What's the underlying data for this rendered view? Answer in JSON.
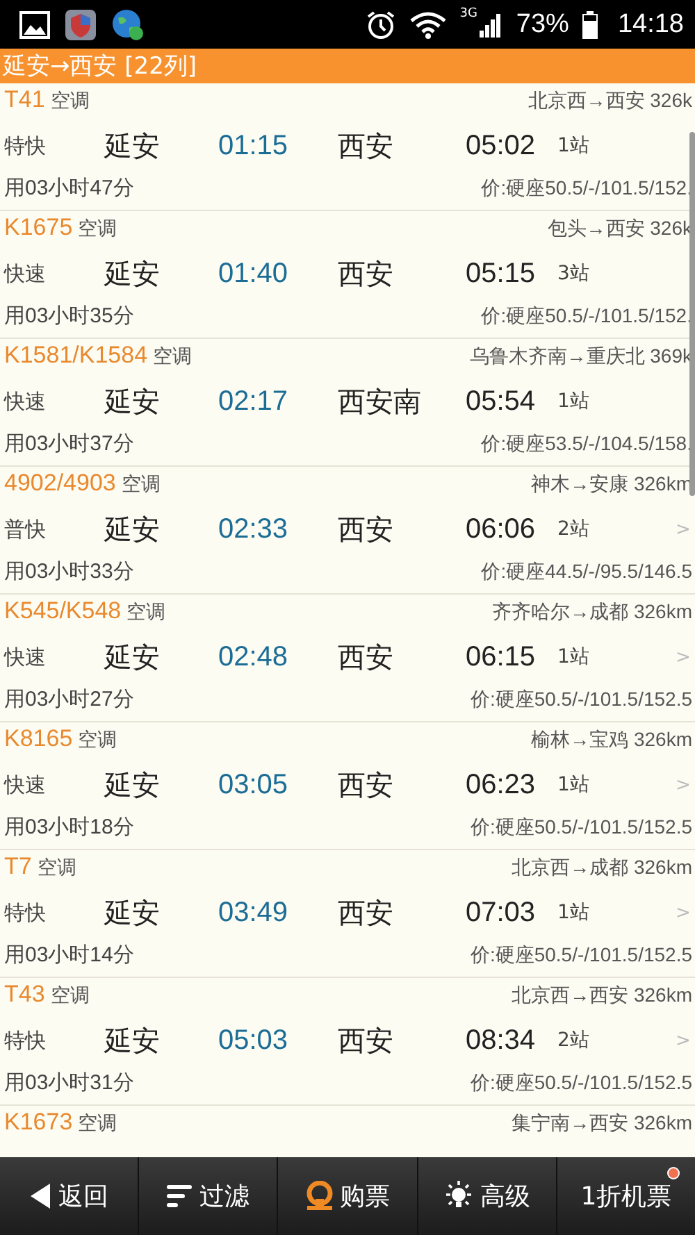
{
  "status_bar": {
    "network": "3G",
    "battery": "73%",
    "time": "14:18"
  },
  "header": {
    "title": "延安→西安 [22列]"
  },
  "trains": [
    {
      "number": "T41",
      "ac": "空调",
      "route": "北京西→西安 326k",
      "type": "特快",
      "from": "延安",
      "depart": "01:15",
      "to": "西安",
      "arrive": "05:02",
      "stops": "1站",
      "duration": "用03小时47分",
      "price": "价:硬座50.5/-/101.5/152."
    },
    {
      "number": "K1675",
      "ac": "空调",
      "route": "包头→西安 326k",
      "type": "快速",
      "from": "延安",
      "depart": "01:40",
      "to": "西安",
      "arrive": "05:15",
      "stops": "3站",
      "duration": "用03小时35分",
      "price": "价:硬座50.5/-/101.5/152."
    },
    {
      "number": "K1581/K1584",
      "ac": "空调",
      "route": "乌鲁木齐南→重庆北 369k",
      "type": "快速",
      "from": "延安",
      "depart": "02:17",
      "to": "西安南",
      "arrive": "05:54",
      "stops": "1站",
      "duration": "用03小时37分",
      "price": "价:硬座53.5/-/104.5/158."
    },
    {
      "number": "4902/4903",
      "ac": "空调",
      "route": "神木→安康 326km",
      "type": "普快",
      "from": "延安",
      "depart": "02:33",
      "to": "西安",
      "arrive": "06:06",
      "stops": "2站",
      "arrow": ">",
      "duration": "用03小时33分",
      "price": "价:硬座44.5/-/95.5/146.5"
    },
    {
      "number": "K545/K548",
      "ac": "空调",
      "route": "齐齐哈尔→成都 326km",
      "type": "快速",
      "from": "延安",
      "depart": "02:48",
      "to": "西安",
      "arrive": "06:15",
      "stops": "1站",
      "arrow": ">",
      "duration": "用03小时27分",
      "price": "价:硬座50.5/-/101.5/152.5"
    },
    {
      "number": "K8165",
      "ac": "空调",
      "route": "榆林→宝鸡 326km",
      "type": "快速",
      "from": "延安",
      "depart": "03:05",
      "to": "西安",
      "arrive": "06:23",
      "stops": "1站",
      "arrow": ">",
      "duration": "用03小时18分",
      "price": "价:硬座50.5/-/101.5/152.5"
    },
    {
      "number": "T7",
      "ac": "空调",
      "route": "北京西→成都 326km",
      "type": "特快",
      "from": "延安",
      "depart": "03:49",
      "to": "西安",
      "arrive": "07:03",
      "stops": "1站",
      "arrow": ">",
      "duration": "用03小时14分",
      "price": "价:硬座50.5/-/101.5/152.5"
    },
    {
      "number": "T43",
      "ac": "空调",
      "route": "北京西→西安 326km",
      "type": "特快",
      "from": "延安",
      "depart": "05:03",
      "to": "西安",
      "arrive": "08:34",
      "stops": "2站",
      "arrow": ">",
      "duration": "用03小时31分",
      "price": "价:硬座50.5/-/101.5/152.5"
    },
    {
      "number": "K1673",
      "ac": "空调",
      "route": "集宁南→西安 326km"
    }
  ],
  "toolbar": [
    {
      "kind": "back",
      "label": "返回",
      "dot": false
    },
    {
      "kind": "filter",
      "label": "过滤",
      "dot": false
    },
    {
      "kind": "rail",
      "label": "购票",
      "dot": false
    },
    {
      "kind": "bulb",
      "label": "高级",
      "dot": false
    },
    {
      "kind": "none",
      "label": "1折机票",
      "dot": true
    }
  ]
}
